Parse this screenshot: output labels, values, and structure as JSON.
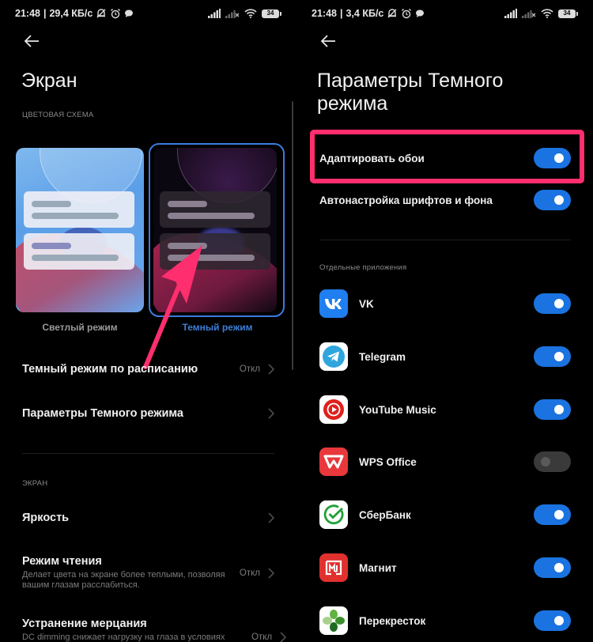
{
  "left_screen": {
    "status_bar": {
      "time": "21:48",
      "speed": "29,4 КБ/с",
      "battery": "34"
    },
    "title": "Экран",
    "section_color_scheme": "ЦВЕТОВАЯ СХЕМА",
    "themes": [
      {
        "label": "Светлый режим",
        "selected": false
      },
      {
        "label": "Темный режим",
        "selected": true
      }
    ],
    "rows_top": [
      {
        "label": "Темный режим по расписанию",
        "value": "Откл"
      },
      {
        "label": "Параметры Темного режима",
        "value": ""
      }
    ],
    "section_screen": "ЭКРАН",
    "rows_screen": [
      {
        "label": "Яркость",
        "sub": "",
        "value": ""
      },
      {
        "label": "Режим чтения",
        "sub": "Делает цвета на экране более теплыми, позволяя вашим глазам расслабиться.",
        "value": "Откл"
      },
      {
        "label": "Устранение мерцания",
        "sub": "DC dimming снижает нагрузку на глаза в условиях",
        "value": "Откл"
      }
    ]
  },
  "right_screen": {
    "status_bar": {
      "time": "21:48",
      "speed": "3,4 КБ/с",
      "battery": "34"
    },
    "title": "Параметры Темного режима",
    "settings": [
      {
        "label": "Адаптировать обои",
        "enabled": true,
        "highlighted": true
      },
      {
        "label": "Автонастройка шрифтов и фона",
        "enabled": true,
        "highlighted": false
      }
    ],
    "section_apps": "Отдельные приложения",
    "apps": [
      {
        "name": "VK",
        "icon": "vk-icon",
        "enabled": true
      },
      {
        "name": "Telegram",
        "icon": "telegram-icon",
        "enabled": true
      },
      {
        "name": "YouTube Music",
        "icon": "youtube-music-icon",
        "enabled": true
      },
      {
        "name": "WPS Office",
        "icon": "wps-office-icon",
        "enabled": false
      },
      {
        "name": "СберБанк",
        "icon": "sberbank-icon",
        "enabled": true
      },
      {
        "name": "Магнит",
        "icon": "magnit-icon",
        "enabled": true
      },
      {
        "name": "Перекресток",
        "icon": "perekrestok-icon",
        "enabled": true
      }
    ]
  },
  "colors": {
    "accent_blue": "#1a73e0",
    "annotation_pink": "#ff2e6e",
    "selected_theme_ring": "#3b7be0"
  }
}
